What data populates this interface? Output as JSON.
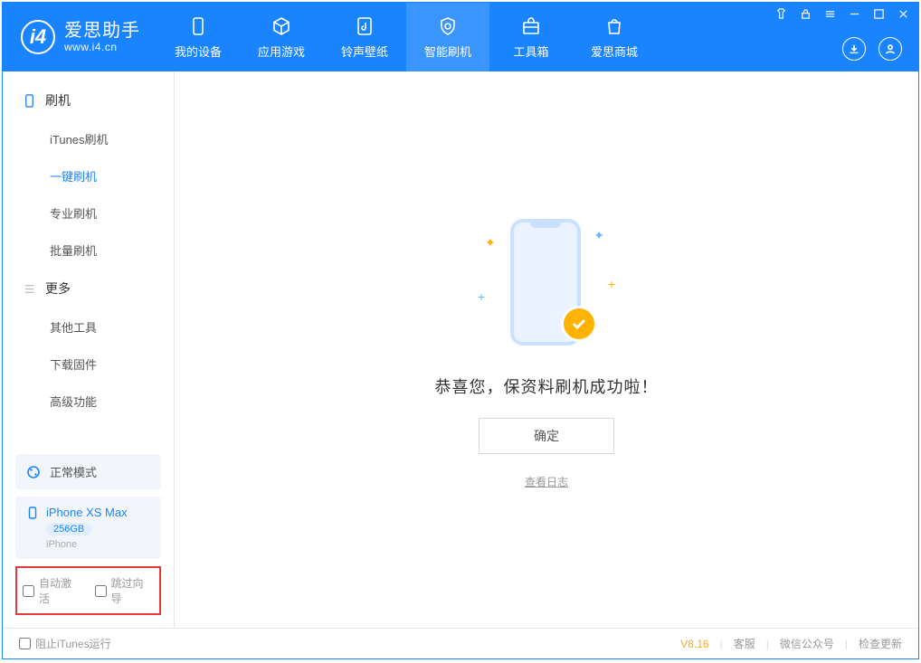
{
  "app": {
    "title": "爱思助手",
    "url": "www.i4.cn"
  },
  "tabs": [
    {
      "label": "我的设备"
    },
    {
      "label": "应用游戏"
    },
    {
      "label": "铃声壁纸"
    },
    {
      "label": "智能刷机"
    },
    {
      "label": "工具箱"
    },
    {
      "label": "爱思商城"
    }
  ],
  "sidebar": {
    "section1": "刷机",
    "items1": [
      "iTunes刷机",
      "一键刷机",
      "专业刷机",
      "批量刷机"
    ],
    "section2": "更多",
    "items2": [
      "其他工具",
      "下载固件",
      "高级功能"
    ],
    "mode": "正常模式",
    "device": {
      "name": "iPhone XS Max",
      "capacity": "256GB",
      "type": "iPhone"
    },
    "opts": {
      "autoActivate": "自动激活",
      "skipWizard": "跳过向导"
    }
  },
  "main": {
    "success": "恭喜您，保资料刷机成功啦！",
    "ok": "确定",
    "viewLog": "查看日志"
  },
  "footer": {
    "blockItunes": "阻止iTunes运行",
    "version": "V8.16",
    "service": "客服",
    "wechat": "微信公众号",
    "update": "检查更新"
  }
}
